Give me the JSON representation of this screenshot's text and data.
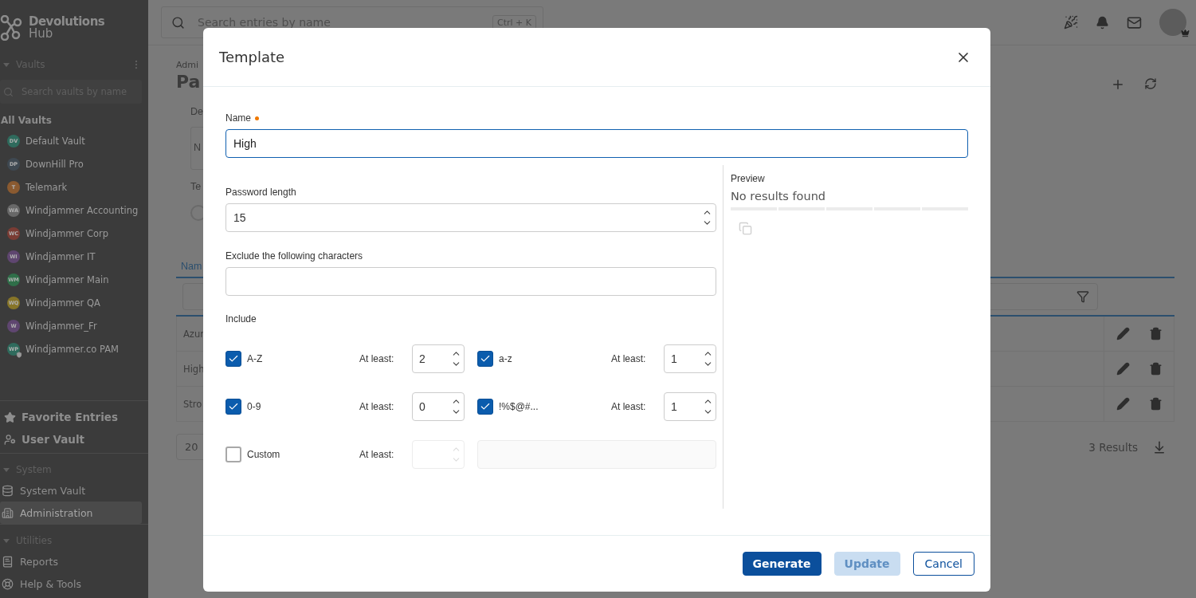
{
  "sidebar": {
    "logo": {
      "brand": "Devolutions",
      "product": "Hub"
    },
    "vaults_header": {
      "title": "Vaults",
      "expanded": true
    },
    "search_placeholder": "Search vaults by name",
    "all_vaults": "All Vaults",
    "vaults": [
      {
        "initials": "DV",
        "name": "Default Vault",
        "color": "#2f6b5d",
        "shield": false
      },
      {
        "initials": "DP",
        "name": "DownHill Pro",
        "color": "#3f4952",
        "shield": false
      },
      {
        "initials": "T",
        "name": "Telemark",
        "color": "#8a5a30",
        "shield": false
      },
      {
        "initials": "WA",
        "name": "Windjammer Accounting",
        "color": "#686868",
        "shield": false
      },
      {
        "initials": "WC",
        "name": "Windjammer Corp",
        "color": "#7a3c34",
        "shield": false
      },
      {
        "initials": "WI",
        "name": "Windjammer IT",
        "color": "#5f4670",
        "shield": false
      },
      {
        "initials": "WM",
        "name": "Windjammer Main",
        "color": "#2f6f49",
        "shield": false
      },
      {
        "initials": "WQ",
        "name": "Windjammer QA",
        "color": "#877528",
        "shield": false
      },
      {
        "initials": "W",
        "name": "Windjammer_Fr",
        "color": "#5f4670",
        "shield": false
      },
      {
        "initials": "WP",
        "name": "Windjammer.co PAM",
        "color": "#2f6b5d",
        "shield": true
      }
    ],
    "pinned": [
      {
        "label": "Favorite Entries"
      },
      {
        "label": "User Vault"
      }
    ],
    "sections": [
      {
        "title": "System",
        "expanded": true,
        "items": [
          {
            "label": "System Vault",
            "selected": false
          },
          {
            "label": "Administration",
            "selected": true
          }
        ]
      },
      {
        "title": "Utilities",
        "expanded": true,
        "items": [
          {
            "label": "Reports",
            "selected": false
          },
          {
            "label": "Help & Tools",
            "selected": false
          }
        ]
      }
    ]
  },
  "topbar": {
    "search_placeholder": "Search entries by name",
    "shortcut": "Ctrl + K"
  },
  "page": {
    "breadcrumb": "Admi",
    "title": "Pa",
    "field_label": "De",
    "field_value": "N",
    "section_label": "Te",
    "radio": {
      "selected": false
    },
    "tab": "Nam",
    "rows": [
      {
        "name": "Azur"
      },
      {
        "name": "High"
      },
      {
        "name": "Stro"
      }
    ],
    "page_size": "20",
    "results": "3 Results"
  },
  "dialog": {
    "title": "Template",
    "name_field": {
      "label": "Name",
      "required": true,
      "value": "High"
    },
    "length_field": {
      "label": "Password length",
      "value": "15"
    },
    "exclude_field": {
      "label": "Exclude the following characters"
    },
    "include_label": "Include",
    "include": [
      {
        "kind": "charset",
        "label": "A-Z",
        "checked": true,
        "min_label": "At least:",
        "min": "2"
      },
      {
        "kind": "charset",
        "label": "a-z",
        "checked": true,
        "min_label": "At least:",
        "min": "1"
      },
      {
        "kind": "charset",
        "label": "0-9",
        "checked": true,
        "min_label": "At least:",
        "min": "0"
      },
      {
        "kind": "charset",
        "label": "!%$@#...",
        "checked": true,
        "min_label": "At least:",
        "min": "1"
      },
      {
        "kind": "custom",
        "label": "Custom",
        "checked": false,
        "min_label": "At least:"
      }
    ],
    "preview": {
      "label": "Preview",
      "text": "No results found",
      "level": 0
    },
    "buttons": [
      {
        "label": "Generate",
        "kind": "primary",
        "disabled": false
      },
      {
        "label": "Update",
        "kind": "primary",
        "disabled": true
      },
      {
        "label": "Cancel",
        "kind": "secondary",
        "disabled": false
      }
    ]
  }
}
